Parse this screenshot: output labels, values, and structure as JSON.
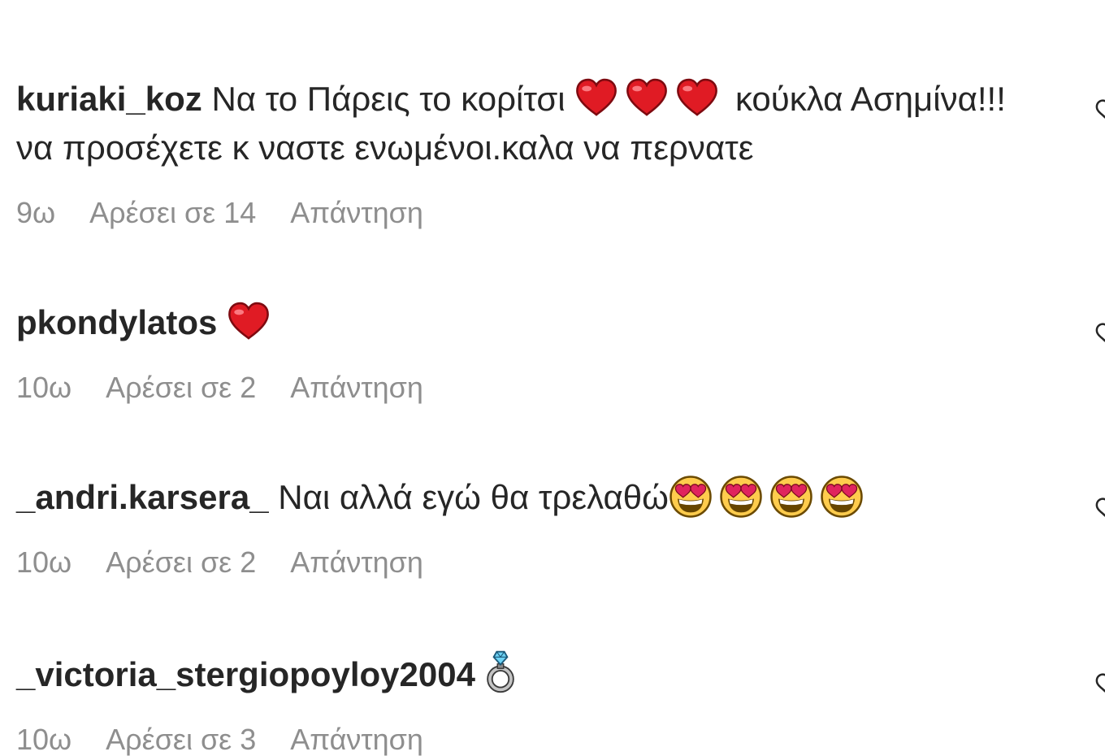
{
  "comments": [
    {
      "username": "kuriaki_koz",
      "text_1": "Να το Πάρεις το κορίτσι",
      "emojis": [
        "red-heart",
        "red-heart",
        "red-heart"
      ],
      "text_2": "κούκλα Ασημίνα!!!να προσέχετε κ ναστε ενωμένοι.καλα να περνατε",
      "time": "9ω",
      "likes": "Αρέσει σε 14",
      "reply": "Απάντηση",
      "like_icon": "heart-outline"
    },
    {
      "username": "pkondylatos",
      "emojis": [
        "red-heart"
      ],
      "time": "10ω",
      "likes": "Αρέσει σε 2",
      "reply": "Απάντηση",
      "like_icon": "heart-outline"
    },
    {
      "username": "_andri.karsera_",
      "text_1": "Ναι αλλά εγώ θα τρελαθώ",
      "emojis": [
        "heart-eyes-face",
        "heart-eyes-face",
        "heart-eyes-face",
        "heart-eyes-face"
      ],
      "time": "10ω",
      "likes": "Αρέσει σε 2",
      "reply": "Απάντηση",
      "like_icon": "heart-outline"
    },
    {
      "username": "_victoria_stergiopoyloy2004",
      "emojis": [
        "ring"
      ],
      "time": "10ω",
      "likes": "Αρέσει σε 3",
      "reply": "Απάντηση",
      "like_icon": "heart-outline"
    }
  ],
  "colors": {
    "text": "#262626",
    "secondary": "#8e8e8e",
    "background": "#ffffff",
    "heart_red": "#e01b24"
  }
}
